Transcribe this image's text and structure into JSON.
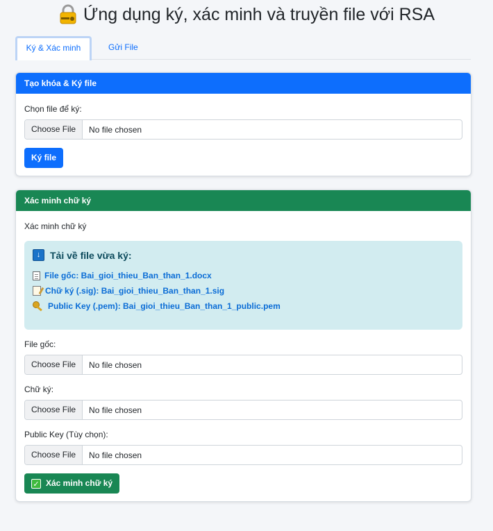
{
  "page": {
    "title": "Ứng dụng ký, xác minh và truyền file với RSA",
    "title_icon": "lock-with-key-icon"
  },
  "tabs": [
    {
      "label": "Ký & Xác minh",
      "active": true
    },
    {
      "label": "Gửi File",
      "active": false
    }
  ],
  "sign_card": {
    "header": "Tạo khóa & Ký file",
    "file_label": "Chọn file để ký:",
    "choose_label": "Choose File",
    "file_value": "No file chosen",
    "sign_button": "Ký file"
  },
  "verify_card": {
    "header": "Xác minh chữ ký",
    "intro": "Xác minh chữ ký",
    "download": {
      "title": "Tải về file vừa ký:",
      "icon": "download-icon",
      "items": [
        {
          "icon": "document-icon",
          "text": "File gốc: Bai_gioi_thieu_Ban_than_1.docx"
        },
        {
          "icon": "signature-icon",
          "text": "Chữ ký (.sig): Bai_gioi_thieu_Ban_than_1.sig"
        },
        {
          "icon": "key-icon",
          "text": "Public Key (.pem): Bai_gioi_thieu_Ban_than_1_public.pem"
        }
      ]
    },
    "fields": [
      {
        "label": "File gốc:",
        "choose_label": "Choose File",
        "value": "No file chosen"
      },
      {
        "label": "Chữ ký:",
        "choose_label": "Choose File",
        "value": "No file chosen"
      },
      {
        "label": "Public Key (Tùy chọn):",
        "choose_label": "Choose File",
        "value": "No file chosen"
      }
    ],
    "verify_button": "Xác minh chữ ký"
  },
  "colors": {
    "primary": "#0d6efd",
    "success": "#198754",
    "info_bg": "#d2ecf0",
    "page_bg": "#f4f6f9"
  }
}
